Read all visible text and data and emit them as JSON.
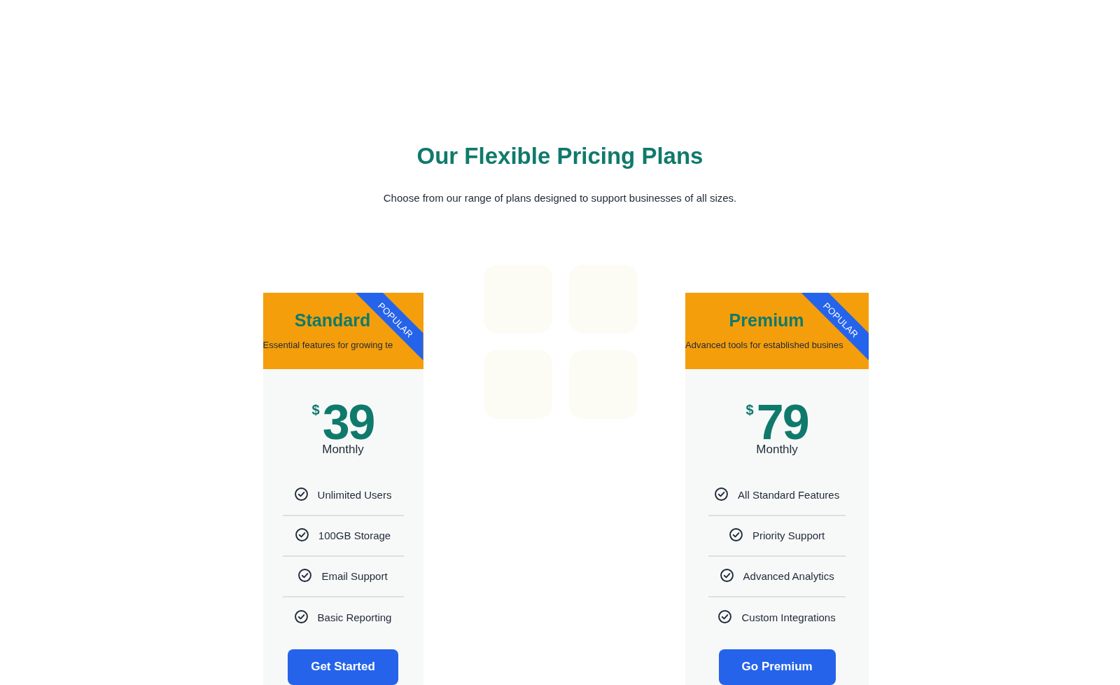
{
  "section": {
    "title": "Our Flexible Pricing Plans",
    "subtitle": "Choose from our range of plans designed to support businesses of all sizes."
  },
  "plans": [
    {
      "name": "Standard",
      "description": "Essential features for growing te",
      "ribbon": "POPULAR",
      "currency": "$",
      "price": "39",
      "period": "Monthly",
      "features": [
        "Unlimited Users",
        "100GB Storage",
        "Email Support",
        "Basic Reporting"
      ],
      "button": "Get Started"
    },
    {
      "name": "Premium",
      "description": "Advanced tools for established busines",
      "ribbon": "POPULAR",
      "currency": "$",
      "price": "79",
      "period": "Monthly",
      "features": [
        "All Standard Features",
        "Priority Support",
        "Advanced Analytics",
        "Custom Integrations"
      ],
      "button": "Go Premium"
    }
  ]
}
